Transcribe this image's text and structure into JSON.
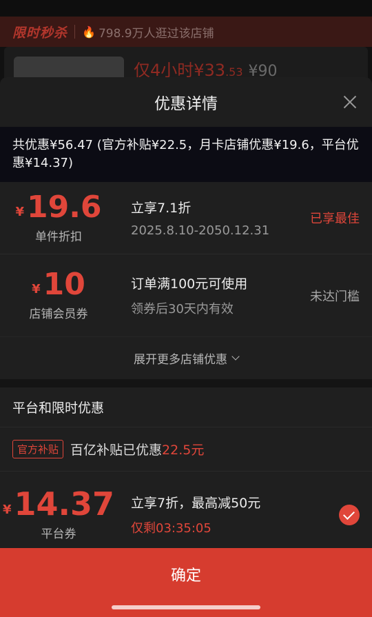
{
  "background": {
    "flash_title": "限时秒杀",
    "visitors": "798.9万人逛过该店铺",
    "price_prefix": "仅4小时¥33",
    "price_decimal": ".53",
    "orig_price": "¥90"
  },
  "sheet": {
    "title": "优惠详情",
    "summary": "共优惠¥56.47 (官方补贴¥22.5，月卡店铺优惠¥19.6，平台优惠¥14.37)"
  },
  "store_coupons": [
    {
      "yen": "¥",
      "amount": "19.6",
      "name": "单件折扣",
      "main": "立享7.1折",
      "sub": "2025.8.10-2050.12.31",
      "status": "已享最佳"
    },
    {
      "yen": "¥",
      "amount": "10",
      "name": "店铺会员券",
      "main": "订单满100元可使用",
      "sub": "领券后30天内有效",
      "status": "未达门槛"
    }
  ],
  "expand_label": "展开更多店铺优惠",
  "platform": {
    "heading": "平台和限时优惠",
    "subsidy_tag": "官方补贴",
    "subsidy_text": "百亿补贴已优惠",
    "subsidy_amount": "22.5元",
    "coupon": {
      "yen": "¥",
      "amount": "14.37",
      "name": "平台券",
      "main": "立享7折，最高减50元",
      "sub": "仅剩03:35:05"
    }
  },
  "confirm_label": "确定",
  "colors": {
    "accent": "#e0463a",
    "confirm_bg": "#d63c2f"
  }
}
